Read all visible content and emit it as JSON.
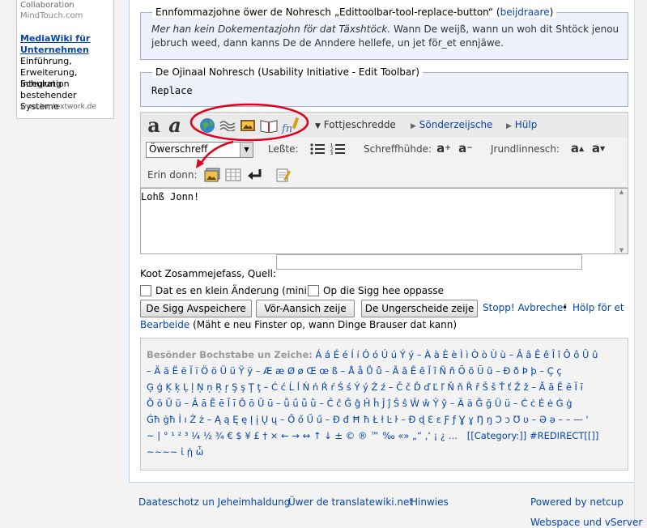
{
  "sidebar": {
    "collab": "Collaboration",
    "mindtouch": "MindTouch.com",
    "link1": "MediaWiki für",
    "link2": "Unternehmen",
    "desc": [
      "Einführung,",
      "Erweiterung, Schulung",
      "Integration",
      "bestehender Systeme"
    ],
    "domain": "www.kontextwork.de"
  },
  "info_box": {
    "legend_text": "Ennfommazjohne öwer de Nohresch „Edittoolbar-tool-replace-button“ (",
    "legend_link": "beijdraare",
    "legend_end": ")",
    "line1_italic": "Mer han kein Dokementazjohn för dat Täxshtöck.",
    "line1_rest": " Wann De weijß, wann un woh dit Shtöck jenou",
    "line2": "jebruch weed, dann kanns De de Anndere hellefe, un jet för_et ennjäwe."
  },
  "original_box": {
    "legend": "De Ojinaal Nohresch (Usability Initiative - Edit Toolbar)",
    "value": "Replace"
  },
  "toolbar": {
    "bold_glyph": "a",
    "italic_glyph": "a",
    "advanced": "Fottjeschredde",
    "special": "Sönderzeijsche",
    "help": "Hülp",
    "format_select": "Öwerschreff",
    "lists_label": "Leßte:",
    "font_size_label": "Schreffhühde:",
    "baseline_label": "Jrundlinnesch:",
    "insert_label": "Erin donn:",
    "sign_glyph": "fn"
  },
  "editor": {
    "content": "Lohß Jonn!"
  },
  "summary": {
    "label": "Koot Zosammejefass, Quell:",
    "value": ""
  },
  "options": {
    "minor": "Dat es en klein Änderung (mini)",
    "watch": "Op die Sigg hee oppasse"
  },
  "actions": {
    "save": "De Sigg Avspeichere",
    "preview": "Vör-Aansich zeije",
    "diff": "De Ungerscheide zeije",
    "cancel": "Stopp! Avbreche!",
    "help_sep": " • ",
    "help_link1": "Hölp för et",
    "help_link2": "Bearbeide",
    "help_note": " (Mäht e neu Finster op, wann Dinge Brauser dat kann)"
  },
  "special_chars": {
    "title": "Besönder Bochstabe un Zeiche:",
    "line0": "Á á É é Í í Ó ó Ú ú Ý ý – À à È è Ì ì Ò ò Ù ù – Â â Ê ê Î î Ô ô Û û",
    "line1": "– Ä ä Ë ë Ï ï Ö ö Ü ü Ÿ ÿ – Æ æ Ø ø Œ œ ß – Å å Ů ů – Ã ã Ẽ ẽ Ĩ ĩ Ñ ñ Õ õ Ũ ũ – Ð ð Þ þ – Ç ç",
    "line2": "Ģ ģ Ķ ķ Ļ ļ Ņ ņ Ŗ ŗ Ş ş Ţ ţ – Ć ć Ĺ ĺ Ń ń Ŕ ŕ Ś ś Ý ý Ź ź – Č č Ď ď Ľ ľ Ň ň Ř ř Š š Ť ť Ž ž – Ă ă Ĕ ĕ Ĭ ĭ",
    "line3": "Ŏ ŏ Ŭ ŭ – Ā ā Ē ē Ī ī Ō ō Ū ū – ǖ ǘ ǚ ǜ – Ĉ ĉ Ĝ ĝ Ĥ ĥ Ĵ ĵ Ŝ ŝ Ŵ ŵ Ŷ ŷ – Ä ä Ğ ğ Ü ü – Ċ ċ Ė ė Ġ ġ",
    "line4": "Ġħ ġħ İ ı Ż ż – Ą ą Ę ę Į į Ų ų – Ő ő Ű ű – Đ đ Ħ ħ Ł ł Ŀ ŀ – Ɖ ɖ Ɛ ɛ Ƒ ƒ Ɣ ɣ Ŋ ŋ Ɔ ɔ Ʊ ʋ – Ə ə – – — '",
    "line5": "~ | ° ¹ ² ³ ¼ ½ ¾ € $ ¥ £ † × ← → ↔ ↑ ↓ ± © ® ™ ‰ «» „“ ‚‘ ¡ ¿ …",
    "category": "[[Category:]]",
    "redirect": "#REDIRECT[[]]",
    "line6": "~~~~ ἰ ᾐ ὦ"
  },
  "footer": {
    "privacy": "Daateschotz un Jeheimhaldung",
    "about": "Üwer de translatewiki.net",
    "disclaimer": "Hinwies",
    "powered": "Powered by netcup",
    "webspace": "Webspace und vServer"
  },
  "colors": {
    "annotation_red": "#e3001b",
    "link_blue": "#0645ad",
    "fieldset_bg": "#eef0fb"
  }
}
